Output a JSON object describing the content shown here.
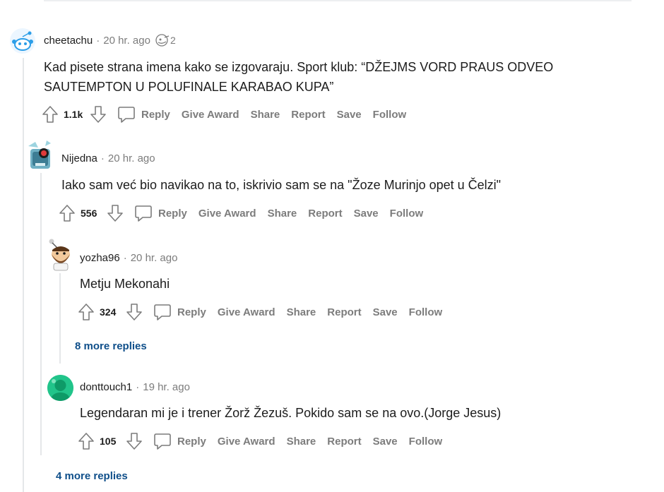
{
  "labels": {
    "reply": "Reply",
    "give_award": "Give Award",
    "share": "Share",
    "report": "Report",
    "save": "Save",
    "follow": "Follow",
    "separator": "·"
  },
  "comments": [
    {
      "username": "cheetachu",
      "time": "20 hr. ago",
      "award_count": "2",
      "body_lines": [
        "Kad pisete strana imena kako se izgovaraju. Sport klub: “DŽEJMS VORD PRAUS ODVEO",
        "SAUTEMPTON U POLUFINALE KARABAO KUPA”"
      ],
      "score": "1.1k",
      "avatar_icon": "snoo-avatar-icon"
    },
    {
      "username": "Nijedna",
      "time": "20 hr. ago",
      "body": "Iako sam već bio navikao na to, iskrivio sam se na \"Žoze Murinjo opet u Čelzi\"",
      "score": "556",
      "avatar_icon": "robot-avatar-icon"
    },
    {
      "username": "yozha96",
      "time": "20 hr. ago",
      "body": "Metju Mekonahi",
      "score": "324",
      "avatar_icon": "bearded-snoo-avatar-icon"
    },
    {
      "username": "donttouch1",
      "time": "19 hr. ago",
      "body": "Legendaran mi je i trener Žorž Žezuš. Pokido sam se na ovo.(Jorge Jesus)",
      "score": "105",
      "avatar_icon": "default-avatar-icon"
    }
  ],
  "more_replies": [
    "8 more replies",
    "4 more replies"
  ],
  "colors": {
    "link": "#0f4f8a",
    "muted": "#7c7c7c",
    "thread_line": "#e5e7e9",
    "avatar_teal": "#21c48a"
  }
}
